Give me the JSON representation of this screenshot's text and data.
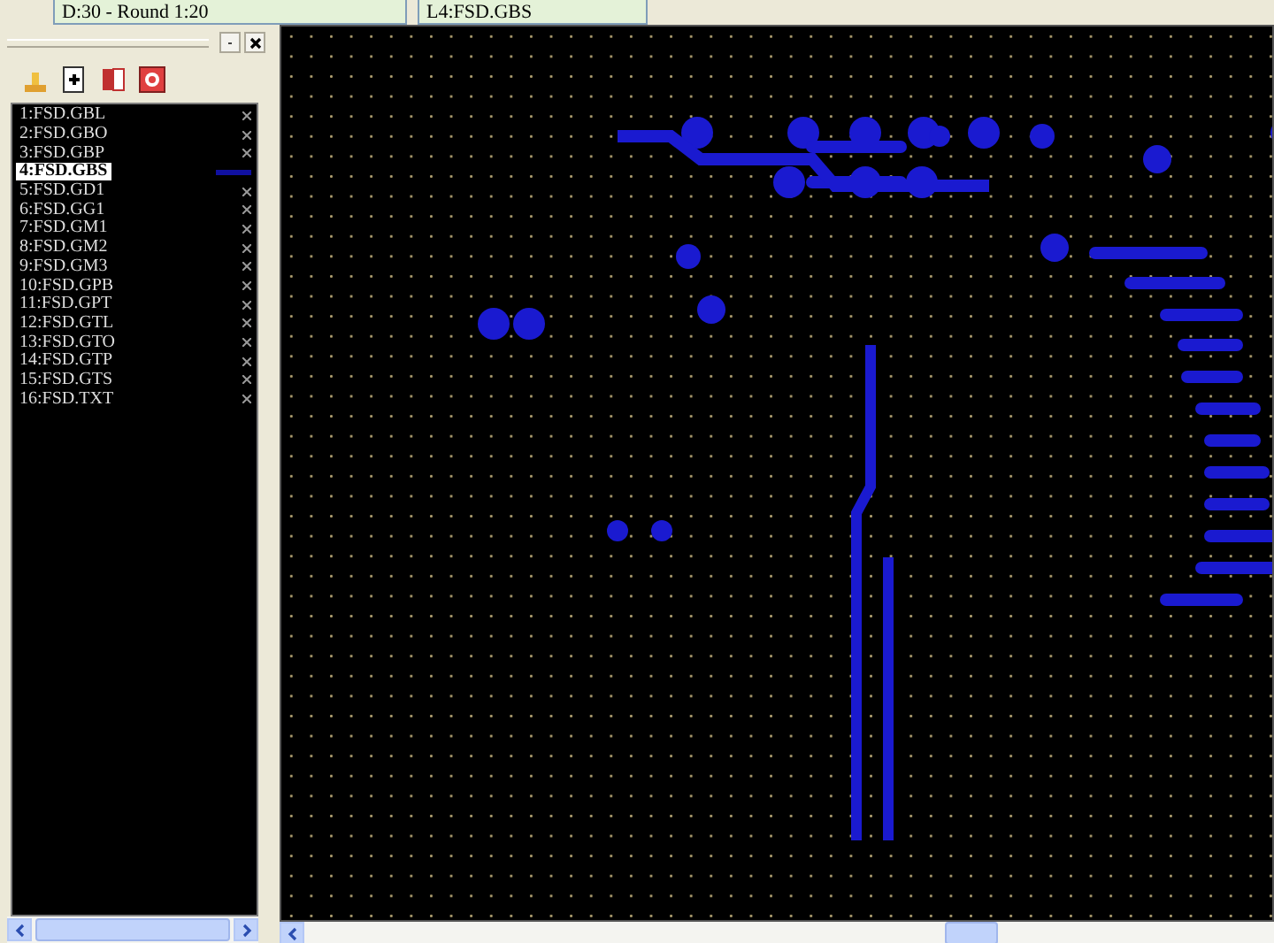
{
  "toolbar": {
    "aperture_combo": "D:30 - Round 1:20",
    "layer_combo": "L4:FSD.GBS"
  },
  "layers_panel": {
    "items": [
      {
        "label": "1:FSD.GBL",
        "selected": false
      },
      {
        "label": "2:FSD.GBO",
        "selected": false
      },
      {
        "label": "3:FSD.GBP",
        "selected": false
      },
      {
        "label": "4:FSD.GBS",
        "selected": true
      },
      {
        "label": "5:FSD.GD1",
        "selected": false
      },
      {
        "label": "6:FSD.GG1",
        "selected": false
      },
      {
        "label": "7:FSD.GM1",
        "selected": false
      },
      {
        "label": "8:FSD.GM2",
        "selected": false
      },
      {
        "label": "9:FSD.GM3",
        "selected": false
      },
      {
        "label": "10:FSD.GPB",
        "selected": false
      },
      {
        "label": "11:FSD.GPT",
        "selected": false
      },
      {
        "label": "12:FSD.GTL",
        "selected": false
      },
      {
        "label": "13:FSD.GTO",
        "selected": false
      },
      {
        "label": "14:FSD.GTP",
        "selected": false
      },
      {
        "label": "15:FSD.GTS",
        "selected": false
      },
      {
        "label": "16:FSD.TXT",
        "selected": false
      }
    ]
  }
}
